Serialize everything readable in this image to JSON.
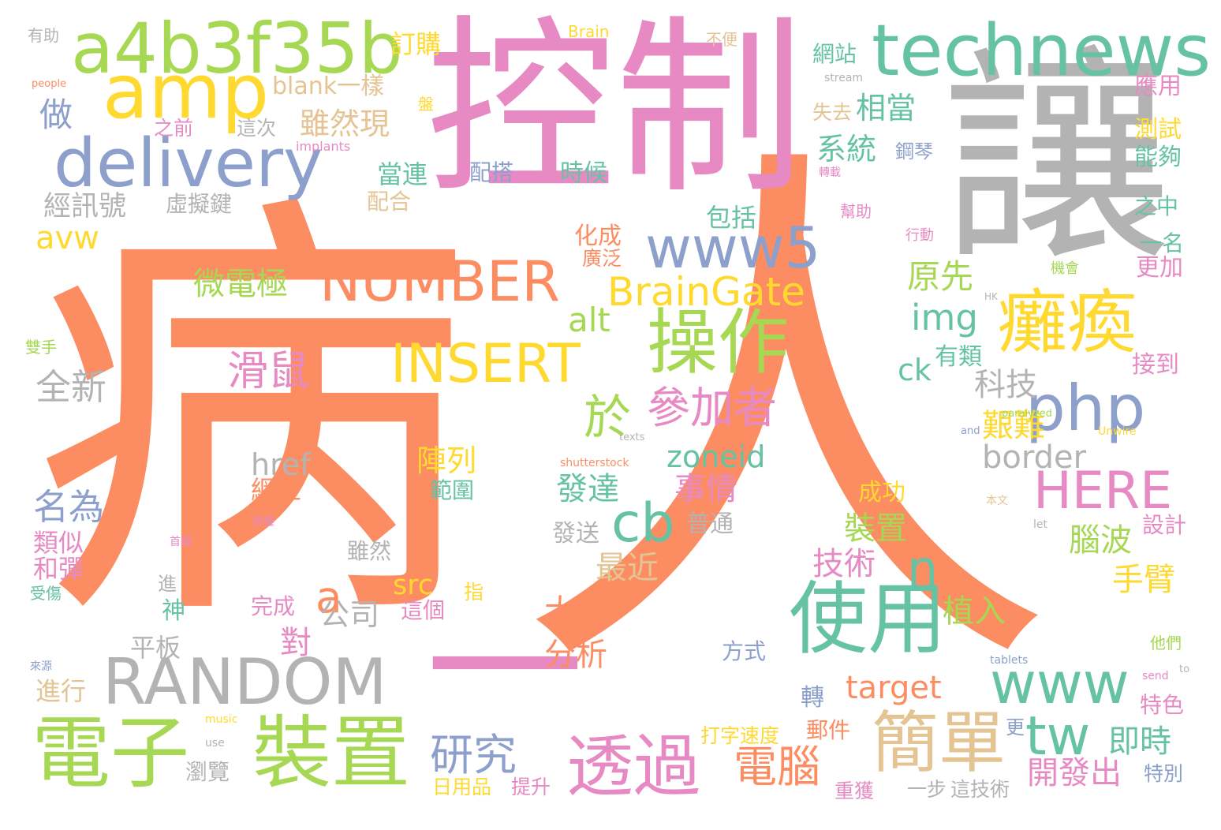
{
  "palette": {
    "orange": "#fc8d62",
    "pink": "#e78ac3",
    "gray": "#b3b3b3",
    "green": "#66c2a5",
    "lime": "#a6d854",
    "yellow": "#ffd92f",
    "blue": "#8da0cb",
    "tan": "#e5c494"
  },
  "words": [
    {
      "text": "病",
      "color": "orange"
    },
    {
      "text": "人",
      "color": "orange"
    },
    {
      "text": "一",
      "color": "pink"
    },
    {
      "text": "控制",
      "color": "pink"
    },
    {
      "text": "讓",
      "color": "gray"
    },
    {
      "text": "technews",
      "color": "green"
    },
    {
      "text": "a4b3f35b",
      "color": "lime"
    },
    {
      "text": "amp",
      "color": "yellow"
    },
    {
      "text": "delivery",
      "color": "blue"
    },
    {
      "text": "www5",
      "color": "blue"
    },
    {
      "text": "NUMBER",
      "color": "orange"
    },
    {
      "text": "BrainGate",
      "color": "yellow"
    },
    {
      "text": "INSERT",
      "color": "yellow"
    },
    {
      "text": "操作",
      "color": "lime"
    },
    {
      "text": "癱瘓",
      "color": "yellow"
    },
    {
      "text": "php",
      "color": "blue"
    },
    {
      "text": "於",
      "color": "lime"
    },
    {
      "text": "參加者",
      "color": "pink"
    },
    {
      "text": "HERE",
      "color": "pink"
    },
    {
      "text": "cb",
      "color": "green"
    },
    {
      "text": "使用",
      "color": "green"
    },
    {
      "text": "RANDOM",
      "color": "gray"
    },
    {
      "text": "電子",
      "color": "lime"
    },
    {
      "text": "裝置",
      "color": "lime"
    },
    {
      "text": "透過",
      "color": "pink"
    },
    {
      "text": "簡單",
      "color": "tan"
    },
    {
      "text": "www",
      "color": "green"
    },
    {
      "text": "tw",
      "color": "green"
    },
    {
      "text": "研究",
      "color": "blue"
    },
    {
      "text": "電腦",
      "color": "orange"
    },
    {
      "text": "n",
      "color": "green"
    },
    {
      "text": "a",
      "color": "orange"
    },
    {
      "text": "滑鼠",
      "color": "pink"
    },
    {
      "text": "微電極",
      "color": "lime"
    },
    {
      "text": "全新",
      "color": "gray"
    },
    {
      "text": "avw",
      "color": "yellow"
    },
    {
      "text": "經訊號",
      "color": "gray"
    },
    {
      "text": "虛擬鍵",
      "color": "gray"
    },
    {
      "text": "做",
      "color": "blue"
    },
    {
      "text": "blank一樣",
      "color": "tan"
    },
    {
      "text": "雖然現",
      "color": "tan"
    },
    {
      "text": "相當",
      "color": "green"
    },
    {
      "text": "系統",
      "color": "green"
    },
    {
      "text": "鋼琴",
      "color": "blue"
    },
    {
      "text": "當連",
      "color": "green"
    },
    {
      "text": "配搭",
      "color": "blue"
    },
    {
      "text": "時候",
      "color": "green"
    },
    {
      "text": "配合",
      "color": "tan"
    },
    {
      "text": "包括",
      "color": "green"
    },
    {
      "text": "化成",
      "color": "orange"
    },
    {
      "text": "廣泛",
      "color": "orange"
    },
    {
      "text": "原先",
      "color": "lime"
    },
    {
      "text": "img",
      "color": "green"
    },
    {
      "text": "alt",
      "color": "lime"
    },
    {
      "text": "ck",
      "color": "green"
    },
    {
      "text": "科技",
      "color": "gray"
    },
    {
      "text": "艱難",
      "color": "yellow"
    },
    {
      "text": "border",
      "color": "gray"
    },
    {
      "text": "zoneid",
      "color": "green"
    },
    {
      "text": "href",
      "color": "gray"
    },
    {
      "text": "陣列",
      "color": "yellow"
    },
    {
      "text": "名為",
      "color": "blue"
    },
    {
      "text": "發達",
      "color": "green"
    },
    {
      "text": "事情",
      "color": "pink"
    },
    {
      "text": "裝置",
      "color": "lime"
    },
    {
      "text": "腦波",
      "color": "lime"
    },
    {
      "text": "技術",
      "color": "pink"
    },
    {
      "text": "最近",
      "color": "tan"
    },
    {
      "text": "手臂",
      "color": "yellow"
    },
    {
      "text": "大腦",
      "color": "orange"
    },
    {
      "text": "src",
      "color": "yellow"
    },
    {
      "text": "神",
      "color": "green"
    },
    {
      "text": "對",
      "color": "pink"
    },
    {
      "text": "公司",
      "color": "gray"
    },
    {
      "text": "分析",
      "color": "orange"
    },
    {
      "text": "植入",
      "color": "lime"
    },
    {
      "text": "target",
      "color": "orange"
    },
    {
      "text": "即時",
      "color": "green"
    },
    {
      "text": "開發出",
      "color": "pink"
    },
    {
      "text": "網上",
      "color": "orange"
    },
    {
      "text": "範圍",
      "color": "green"
    },
    {
      "text": "類似",
      "color": "pink"
    },
    {
      "text": "和彈",
      "color": "pink"
    },
    {
      "text": "平板",
      "color": "gray"
    },
    {
      "text": "進行",
      "color": "tan"
    },
    {
      "text": "完成",
      "color": "pink"
    },
    {
      "text": "這個",
      "color": "pink"
    },
    {
      "text": "雖然",
      "color": "gray"
    },
    {
      "text": "發送",
      "color": "gray"
    },
    {
      "text": "普通",
      "color": "gray"
    },
    {
      "text": "成功",
      "color": "yellow"
    },
    {
      "text": "方式",
      "color": "blue"
    },
    {
      "text": "轉",
      "color": "blue"
    },
    {
      "text": "郵件",
      "color": "orange"
    },
    {
      "text": "打字速度",
      "color": "yellow"
    },
    {
      "text": "日用品",
      "color": "yellow"
    },
    {
      "text": "提升",
      "color": "pink"
    },
    {
      "text": "一步",
      "color": "gray"
    },
    {
      "text": "這技術",
      "color": "gray"
    },
    {
      "text": "特別",
      "color": "blue"
    },
    {
      "text": "特色",
      "color": "pink"
    },
    {
      "text": "瀏覽",
      "color": "gray"
    },
    {
      "text": "重獲",
      "color": "pink"
    },
    {
      "text": "設計",
      "color": "pink"
    },
    {
      "text": "有類",
      "color": "green"
    },
    {
      "text": "接到",
      "color": "pink"
    },
    {
      "text": "更加",
      "color": "pink"
    },
    {
      "text": "一名",
      "color": "green"
    },
    {
      "text": "之中",
      "color": "green"
    },
    {
      "text": "能夠",
      "color": "green"
    },
    {
      "text": "測試",
      "color": "yellow"
    },
    {
      "text": "應用",
      "color": "pink"
    },
    {
      "text": "網站",
      "color": "green"
    },
    {
      "text": "失去",
      "color": "tan"
    },
    {
      "text": "訂購",
      "color": "yellow"
    },
    {
      "text": "之前",
      "color": "pink"
    },
    {
      "text": "這次",
      "color": "gray"
    },
    {
      "text": "有助",
      "color": "gray"
    },
    {
      "text": "不便",
      "color": "tan"
    },
    {
      "text": "Brain",
      "color": "yellow"
    },
    {
      "text": "people",
      "color": "orange"
    },
    {
      "text": "stream",
      "color": "gray"
    },
    {
      "text": "盤",
      "color": "yellow"
    },
    {
      "text": "implants",
      "color": "pink"
    },
    {
      "text": "轉載",
      "color": "pink"
    },
    {
      "text": "幫助",
      "color": "pink"
    },
    {
      "text": "行動",
      "color": "pink"
    },
    {
      "text": "機會",
      "color": "lime"
    },
    {
      "text": "HK",
      "color": "gray"
    },
    {
      "text": "雙手",
      "color": "lime"
    },
    {
      "text": "paralyzed",
      "color": "lime"
    },
    {
      "text": "Unwire",
      "color": "yellow"
    },
    {
      "text": "and",
      "color": "blue"
    },
    {
      "text": "texts",
      "color": "gray"
    },
    {
      "text": "shutterstock",
      "color": "orange"
    },
    {
      "text": "本文",
      "color": "tan"
    },
    {
      "text": "授權",
      "color": "pink"
    },
    {
      "text": "首圖",
      "color": "pink"
    },
    {
      "text": "let",
      "color": "gray"
    },
    {
      "text": "進",
      "color": "gray"
    },
    {
      "text": "受傷",
      "color": "green"
    },
    {
      "text": "指",
      "color": "yellow"
    },
    {
      "text": "更",
      "color": "blue"
    },
    {
      "text": "他們",
      "color": "lime"
    },
    {
      "text": "tablets",
      "color": "blue"
    },
    {
      "text": "send",
      "color": "pink"
    },
    {
      "text": "to",
      "color": "gray"
    },
    {
      "text": "來源",
      "color": "blue"
    },
    {
      "text": "music",
      "color": "yellow"
    },
    {
      "text": "use",
      "color": "gray"
    }
  ]
}
